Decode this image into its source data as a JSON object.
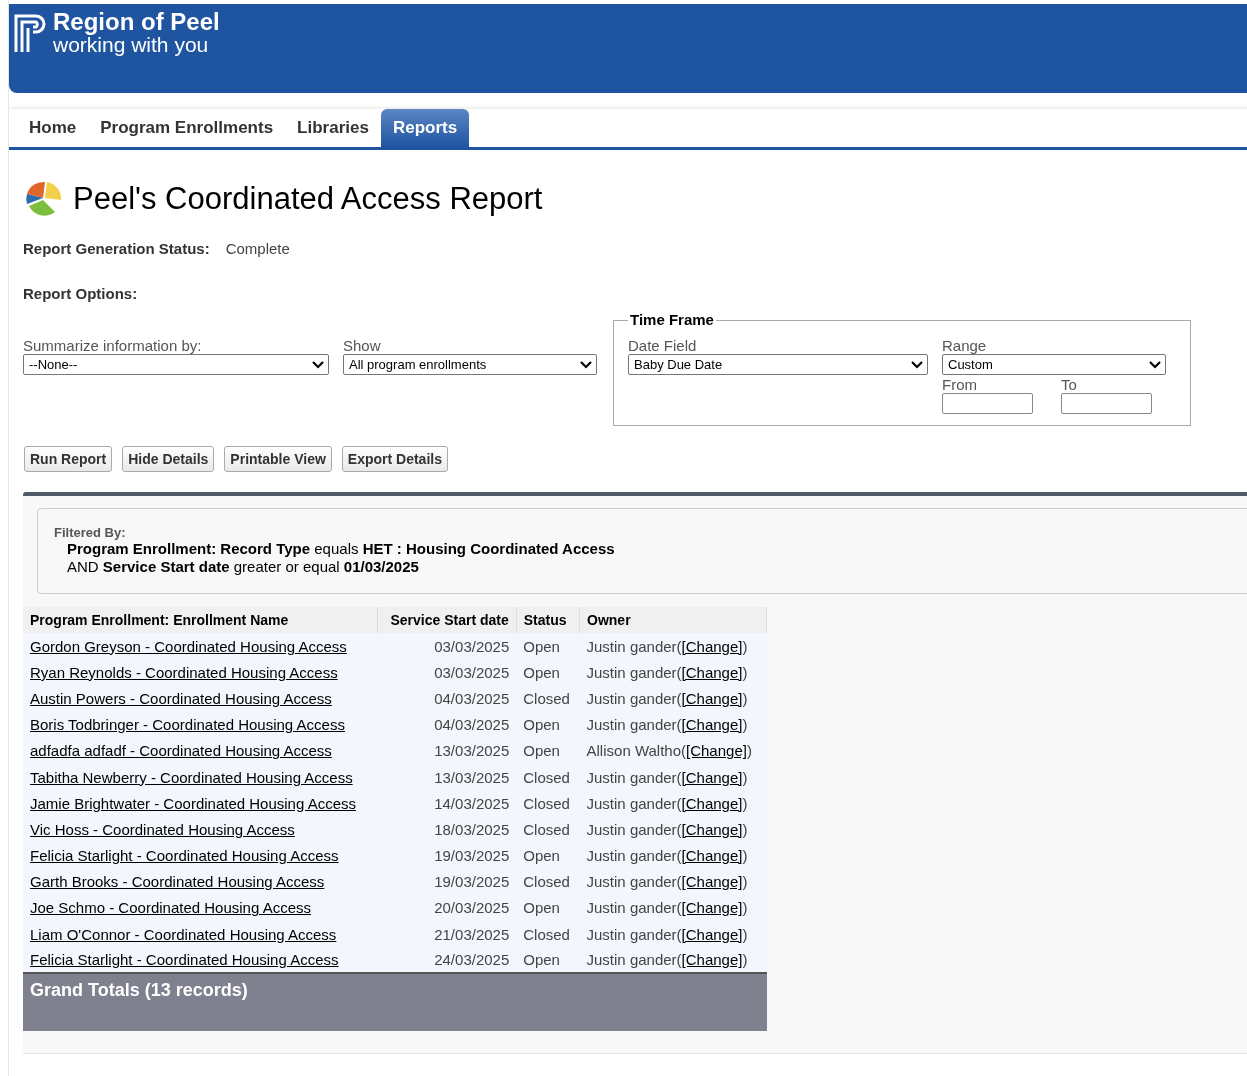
{
  "header": {
    "brand": "Region of Peel",
    "tagline": "working with you"
  },
  "tabs": [
    {
      "label": "Home",
      "selected": false
    },
    {
      "label": "Program Enrollments",
      "selected": false
    },
    {
      "label": "Libraries",
      "selected": false
    },
    {
      "label": "Reports",
      "selected": true
    }
  ],
  "title": "Peel's Coordinated Access Report",
  "status": {
    "label": "Report Generation Status:",
    "value": "Complete"
  },
  "options_heading": "Report Options:",
  "options": [
    {
      "label": "Summarize information by:",
      "value": "--None--"
    },
    {
      "label": "Show",
      "value": "All program enrollments"
    }
  ],
  "time_frame": {
    "legend": "Time Frame",
    "date_field": {
      "label": "Date Field",
      "value": "Baby Due Date"
    },
    "range": {
      "label": "Range",
      "value": "Custom"
    },
    "from": {
      "label": "From"
    },
    "to": {
      "label": "To"
    }
  },
  "buttons": [
    "Run Report",
    "Hide Details",
    "Printable View",
    "Export Details"
  ],
  "filter": {
    "heading": "Filtered By:",
    "lines": [
      "**Program Enrollment: Record Type** equals **HET : Housing Coordinated Access**",
      "AND **Service Start date** greater or equal **01/03/2025**"
    ]
  },
  "table": {
    "columns": [
      "Program Enrollment: Enrollment Name",
      "Service Start date",
      "Status",
      "Owner"
    ],
    "rows": [
      {
        "name": "Gordon Greyson - Coordinated Housing Access",
        "date": "03/03/2025",
        "status": "Open",
        "owner": "Justin gander(",
        "link": "[Change]",
        "end": ")"
      },
      {
        "name": "Ryan Reynolds - Coordinated Housing Access",
        "date": "03/03/2025",
        "status": "Open",
        "owner": "Justin gander(",
        "link": "[Change]",
        "end": ")"
      },
      {
        "name": "Austin Powers - Coordinated Housing Access",
        "date": "04/03/2025",
        "status": "Closed",
        "owner": "Justin gander(",
        "link": "[Change]",
        "end": ")"
      },
      {
        "name": "Boris Todbringer - Coordinated Housing Access",
        "date": "04/03/2025",
        "status": "Open",
        "owner": "Justin gander(",
        "link": "[Change]",
        "end": ")"
      },
      {
        "name": "adfadfa adfadf - Coordinated Housing Access",
        "date": "13/03/2025",
        "status": "Open",
        "owner": "Allison Waltho(",
        "link": "[Change]",
        "end": ")"
      },
      {
        "name": "Tabitha Newberry - Coordinated Housing Access",
        "date": "13/03/2025",
        "status": "Closed",
        "owner": "Justin gander(",
        "link": "[Change]",
        "end": ")"
      },
      {
        "name": "Jamie Brightwater - Coordinated Housing Access",
        "date": "14/03/2025",
        "status": "Closed",
        "owner": "Justin gander(",
        "link": "[Change]",
        "end": ")"
      },
      {
        "name": "Vic Hoss - Coordinated Housing Access",
        "date": "18/03/2025",
        "status": "Closed",
        "owner": "Justin gander(",
        "link": "[Change]",
        "end": ")"
      },
      {
        "name": "Felicia Starlight - Coordinated Housing Access",
        "date": "19/03/2025",
        "status": "Open",
        "owner": "Justin gander(",
        "link": "[Change]",
        "end": ")"
      },
      {
        "name": "Garth Brooks - Coordinated Housing Access",
        "date": "19/03/2025",
        "status": "Closed",
        "owner": "Justin gander(",
        "link": "[Change]",
        "end": ")"
      },
      {
        "name": "Joe Schmo - Coordinated Housing Access",
        "date": "20/03/2025",
        "status": "Open",
        "owner": "Justin gander(",
        "link": "[Change]",
        "end": ")"
      },
      {
        "name": "Liam O'Connor - Coordinated Housing Access",
        "date": "21/03/2025",
        "status": "Closed",
        "owner": "Justin gander(",
        "link": "[Change]",
        "end": ")"
      },
      {
        "name": "Felicia Starlight - Coordinated Housing Access",
        "date": "24/03/2025",
        "status": "Open",
        "owner": "Justin gander(",
        "link": "[Change]",
        "end": ")"
      }
    ],
    "grand_total": "Grand Totals (13 records)"
  }
}
